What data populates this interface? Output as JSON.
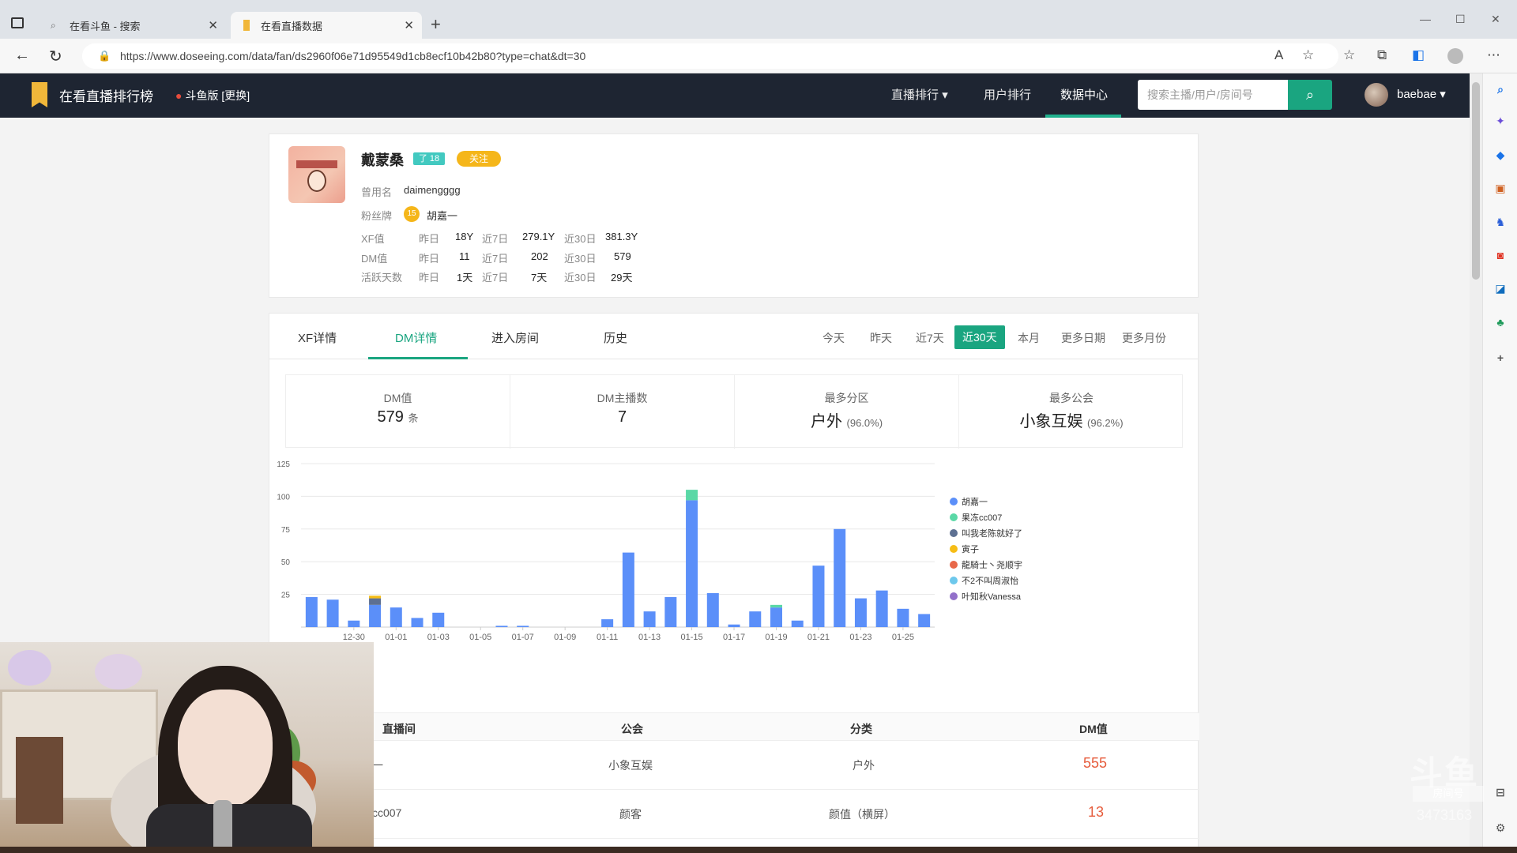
{
  "browser": {
    "tabs": [
      {
        "title": "在看斗鱼 - 搜索",
        "active": false
      },
      {
        "title": "在看直播数据",
        "active": true
      }
    ],
    "url": "https://www.doseeing.com/data/fan/ds2960f06e71d95549d1cb8ecf10b42b80?type=chat&dt=30"
  },
  "site": {
    "title": "在看直播排行榜",
    "location": "斗鱼版 [更换]",
    "nav": [
      "直播排行",
      "用户排行",
      "数据中心"
    ],
    "active_nav": "数据中心",
    "search_placeholder": "搜索主播/用户/房间号",
    "username": "baebae",
    "accent_color": "#1aa580"
  },
  "profile": {
    "name": "戴蒙桑",
    "level_badge": "了 18",
    "follow_label": "关注",
    "used_name_label": "曾用名",
    "used_name": "daimengggg",
    "fan_badge_label": "粉丝牌",
    "fan_badge_level": "15",
    "fan_badge_name": "胡嘉一",
    "period_labels": [
      "昨日",
      "近7日",
      "近30日"
    ],
    "stats": [
      {
        "label": "XF值",
        "values": [
          "18Y",
          "279.1Y",
          "381.3Y"
        ]
      },
      {
        "label": "DM值",
        "values": [
          "11",
          "202",
          "579"
        ]
      },
      {
        "label": "活跃天数",
        "values": [
          "1天",
          "7天",
          "29天"
        ]
      }
    ]
  },
  "detail": {
    "tabs": [
      "XF详情",
      "DM详情",
      "进入房间",
      "历史"
    ],
    "active_tab": "DM详情",
    "ranges": [
      "今天",
      "昨天",
      "近7天",
      "近30天",
      "本月",
      "更多日期",
      "更多月份"
    ],
    "active_range": "近30天",
    "summary": [
      {
        "label": "DM值",
        "value": "579",
        "unit": "条"
      },
      {
        "label": "DM主播数",
        "value": "7",
        "unit": ""
      },
      {
        "label": "最多分区",
        "value": "户外",
        "unit": "(96.0%)"
      },
      {
        "label": "最多公会",
        "value": "小象互娱",
        "unit": "(96.2%)"
      }
    ]
  },
  "chart_data": {
    "type": "bar",
    "stacked": true,
    "categories": [
      "12-28",
      "12-29",
      "12-30",
      "12-31",
      "01-01",
      "01-02",
      "01-03",
      "01-04",
      "01-05",
      "01-06",
      "01-07",
      "01-08",
      "01-09",
      "01-10",
      "01-11",
      "01-12",
      "01-13",
      "01-14",
      "01-15",
      "01-16",
      "01-17",
      "01-18",
      "01-19",
      "01-20",
      "01-21",
      "01-22",
      "01-23",
      "01-24",
      "01-25",
      "01-26"
    ],
    "tick_labels": [
      "12-30",
      "01-01",
      "01-03",
      "01-05",
      "01-07",
      "01-09",
      "01-11",
      "01-13",
      "01-15",
      "01-17",
      "01-19",
      "01-21",
      "01-23",
      "01-25"
    ],
    "ylim": [
      0,
      125
    ],
    "yticks": [
      25,
      50,
      75,
      100,
      125
    ],
    "grid": true,
    "legend_position": "right",
    "series": [
      {
        "name": "胡嘉一",
        "color": "#5b8ff9",
        "values": [
          23,
          21,
          5,
          17,
          15,
          7,
          11,
          0,
          0,
          1,
          1,
          0,
          0,
          0,
          6,
          57,
          12,
          23,
          97,
          26,
          2,
          12,
          15,
          5,
          47,
          75,
          22,
          28,
          14,
          10
        ]
      },
      {
        "name": "果冻cc007",
        "color": "#5ad8a6",
        "values": [
          0,
          0,
          0,
          0,
          0,
          0,
          0,
          0,
          0,
          0,
          0,
          0,
          0,
          0,
          0,
          0,
          0,
          0,
          8,
          0,
          0,
          0,
          2,
          0,
          0,
          0,
          0,
          0,
          0,
          0
        ]
      },
      {
        "name": "叫我老陈就好了",
        "color": "#5d7092",
        "values": [
          0,
          0,
          0,
          5,
          0,
          0,
          0,
          0,
          0,
          0,
          0,
          0,
          0,
          0,
          0,
          0,
          0,
          0,
          0,
          0,
          0,
          0,
          0,
          0,
          0,
          0,
          0,
          0,
          0,
          0
        ]
      },
      {
        "name": "寅子",
        "color": "#f6bd16",
        "values": [
          0,
          0,
          0,
          2,
          0,
          0,
          0,
          0,
          0,
          0,
          0,
          0,
          0,
          0,
          0,
          0,
          0,
          0,
          0,
          0,
          0,
          0,
          0,
          0,
          0,
          0,
          0,
          0,
          0,
          0
        ]
      },
      {
        "name": "龍騎士丶尧顺宇",
        "color": "#e8684a",
        "values": [
          0,
          0,
          0,
          0,
          0,
          0,
          0,
          0,
          0,
          0,
          0,
          0,
          0,
          0,
          0,
          0,
          0,
          0,
          0,
          0,
          0,
          0,
          0,
          0,
          0,
          0,
          0,
          0,
          0,
          0
        ]
      },
      {
        "name": "不2不叫周淑怡",
        "color": "#6dc8ec",
        "values": [
          0,
          0,
          0,
          0,
          0,
          0,
          0,
          0,
          0,
          0,
          0,
          0,
          0,
          0,
          0,
          0,
          0,
          0,
          0,
          0,
          0,
          0,
          0,
          0,
          0,
          0,
          0,
          0,
          0,
          0
        ]
      },
      {
        "name": "叶知秋Vanessa",
        "color": "#9270ca",
        "values": [
          0,
          0,
          0,
          0,
          0,
          0,
          0,
          0,
          0,
          0,
          0,
          0,
          0,
          0,
          0,
          0,
          0,
          0,
          0,
          0,
          0,
          0,
          0,
          0,
          0,
          0,
          0,
          0,
          0,
          0
        ]
      }
    ]
  },
  "table": {
    "headers": [
      "直播间",
      "公会",
      "分类",
      "DM值"
    ],
    "rows": [
      {
        "room": "一",
        "guild": "小象互娱",
        "category": "户外",
        "dm": "555"
      },
      {
        "room": "cc007",
        "guild": "颜客",
        "category": "颜值（横屏）",
        "dm": "13"
      }
    ]
  },
  "overlay": {
    "watermark": "斗鱼",
    "watermark_sub": "房间号",
    "room_number": "3473163"
  }
}
